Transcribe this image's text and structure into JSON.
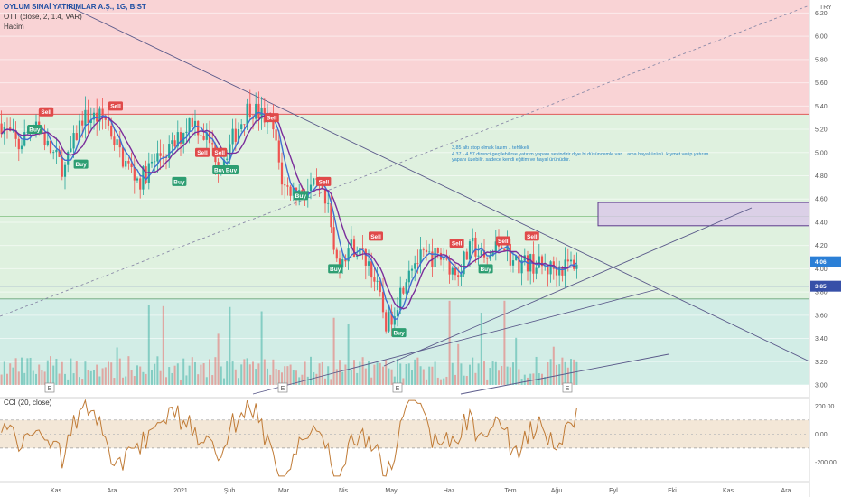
{
  "header": {
    "symbol_title": "OYLUM SINAİ YATIRIMLAR A.Ş., 1G, BIST",
    "indicator_label": "OTT (close, 2, 1.4, VAR)",
    "volume_label": "Hacim",
    "cci_label": "CCI (20, close)",
    "currency": "TRY"
  },
  "annotation_text": [
    "3,85 altı stop olmak lazım .. tehlikeli",
    "4.37 - 4.57 direnci geçilebilirse yatırım yapanı sevindirir diye bi düşüncemle var .. ama hayal ürünü. kıymet verip yatırım",
    "yapanı üzebilir. sadece kendi eğitim ve hayal ürünüdür."
  ],
  "colors": {
    "sell_zone": "#f9d3d5",
    "mid_zone": "#dff1df",
    "low_zone": "#d2ede6",
    "bull_candle": "#26a69a",
    "bear_candle": "#ef5350",
    "ott_line": "#3f6fd1",
    "ott_support": "#7b2d9b",
    "level_line": "#3750a8",
    "sell_line": "#e0585a",
    "cci_line": "#c07b36",
    "cci_band": "#f3e7d7",
    "box_fill": "#d9c8e8",
    "box_border": "#5d3d8a"
  },
  "chart_data": [
    {
      "type": "candlestick",
      "title": "OYLUM SINAİ YATIRIMLAR A.Ş., 1G, BIST",
      "y_axis_side": "right",
      "ylim": [
        3.0,
        6.25
      ],
      "yticks": [
        "6.20",
        "6.00",
        "5.80",
        "5.60",
        "5.40",
        "5.20",
        "5.00",
        "4.80",
        "4.60",
        "4.40",
        "4.20",
        "4.00",
        "3.80",
        "3.60",
        "3.40",
        "3.20",
        "3.00"
      ],
      "x_ticks": [
        "Kas",
        "Ara",
        "2021",
        "Şub",
        "Mar",
        "Nis",
        "May",
        "Haz",
        "Tem",
        "Ağu",
        "Eyl",
        "Eki",
        "Kas",
        "Ara"
      ],
      "close_trend": [
        {
          "t": 0,
          "v": 5.25
        },
        {
          "t": 0.03,
          "v": 5.05
        },
        {
          "t": 0.06,
          "v": 5.3
        },
        {
          "t": 0.08,
          "v": 5.05
        },
        {
          "t": 0.11,
          "v": 4.85
        },
        {
          "t": 0.14,
          "v": 5.3
        },
        {
          "t": 0.18,
          "v": 5.3
        },
        {
          "t": 0.21,
          "v": 4.95
        },
        {
          "t": 0.24,
          "v": 4.75
        },
        {
          "t": 0.27,
          "v": 4.95
        },
        {
          "t": 0.3,
          "v": 5.05
        },
        {
          "t": 0.33,
          "v": 5.3
        },
        {
          "t": 0.36,
          "v": 5.1
        },
        {
          "t": 0.38,
          "v": 4.9
        },
        {
          "t": 0.41,
          "v": 5.2
        },
        {
          "t": 0.43,
          "v": 5.4
        },
        {
          "t": 0.47,
          "v": 5.25
        },
        {
          "t": 0.49,
          "v": 4.7
        },
        {
          "t": 0.52,
          "v": 4.65
        },
        {
          "t": 0.55,
          "v": 4.7
        },
        {
          "t": 0.57,
          "v": 4.45
        },
        {
          "t": 0.58,
          "v": 4.05
        },
        {
          "t": 0.61,
          "v": 4.2
        },
        {
          "t": 0.64,
          "v": 4.05
        },
        {
          "t": 0.66,
          "v": 3.7
        },
        {
          "t": 0.67,
          "v": 3.5
        },
        {
          "t": 0.69,
          "v": 3.75
        },
        {
          "t": 0.71,
          "v": 4.05
        },
        {
          "t": 0.74,
          "v": 4.1
        },
        {
          "t": 0.77,
          "v": 4.1
        },
        {
          "t": 0.79,
          "v": 3.95
        },
        {
          "t": 0.82,
          "v": 4.2
        },
        {
          "t": 0.84,
          "v": 4.05
        },
        {
          "t": 0.87,
          "v": 4.25
        },
        {
          "t": 0.89,
          "v": 4.05
        },
        {
          "t": 0.92,
          "v": 4.05
        },
        {
          "t": 0.95,
          "v": 4.0
        },
        {
          "t": 0.98,
          "v": 4.02
        },
        {
          "t": 1,
          "v": 4.06
        }
      ],
      "signals": [
        {
          "label": "Buy",
          "price": 5.2,
          "t": 0.06
        },
        {
          "label": "Sell",
          "price": 5.35,
          "t": 0.08
        },
        {
          "label": "Buy",
          "price": 4.9,
          "t": 0.14
        },
        {
          "label": "Sell",
          "price": 5.4,
          "t": 0.2
        },
        {
          "label": "Buy",
          "price": 4.75,
          "t": 0.31
        },
        {
          "label": "Sell",
          "price": 5.0,
          "t": 0.35
        },
        {
          "label": "Sell",
          "price": 5.0,
          "t": 0.38
        },
        {
          "label": "Buy",
          "price": 4.85,
          "t": 0.38
        },
        {
          "label": "Buy",
          "price": 4.85,
          "t": 0.4
        },
        {
          "label": "Sell",
          "price": 5.3,
          "t": 0.47
        },
        {
          "label": "Buy",
          "price": 4.63,
          "t": 0.52
        },
        {
          "label": "Sell",
          "price": 4.75,
          "t": 0.56
        },
        {
          "label": "Buy",
          "price": 4.0,
          "t": 0.58
        },
        {
          "label": "Sell",
          "price": 4.28,
          "t": 0.65
        },
        {
          "label": "Buy",
          "price": 3.45,
          "t": 0.69
        },
        {
          "label": "Sell",
          "price": 4.22,
          "t": 0.79
        },
        {
          "label": "Buy",
          "price": 4.0,
          "t": 0.84
        },
        {
          "label": "Sell",
          "price": 4.24,
          "t": 0.87
        },
        {
          "label": "Sell",
          "price": 4.28,
          "t": 0.92
        }
      ],
      "last_price": "4.06",
      "support_level": "3.85",
      "sell_level": 5.33,
      "mid_level": 4.45,
      "low_level": 3.74,
      "resistance_box": [
        4.37,
        4.57
      ]
    },
    {
      "type": "line",
      "title": "CCI (20, close)",
      "yticks": [
        "200.00",
        "0.00",
        "-200.00"
      ],
      "band": [
        -100,
        100
      ],
      "ylim": [
        -320,
        260
      ]
    }
  ]
}
